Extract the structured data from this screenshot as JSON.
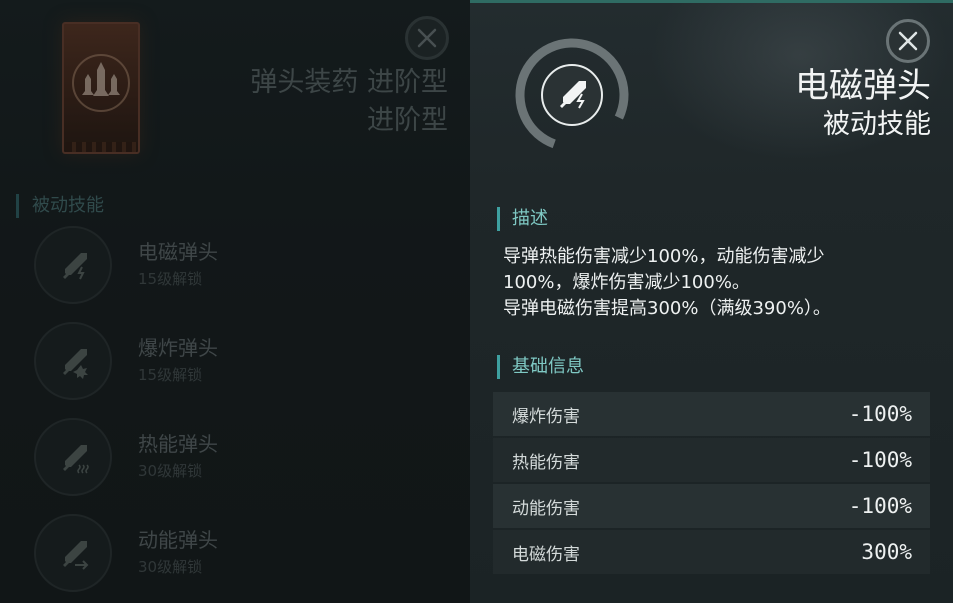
{
  "left_panel": {
    "title": "弹头装药 进阶型",
    "subtitle": "进阶型",
    "section_label": "被动技能",
    "skills": [
      {
        "name": "电磁弹头",
        "unlock": "15级解锁",
        "icon": "missile-electric-icon"
      },
      {
        "name": "爆炸弹头",
        "unlock": "15级解锁",
        "icon": "missile-explosive-icon"
      },
      {
        "name": "热能弹头",
        "unlock": "30级解锁",
        "icon": "missile-thermal-icon"
      },
      {
        "name": "动能弹头",
        "unlock": "30级解锁",
        "icon": "missile-kinetic-icon"
      }
    ]
  },
  "detail": {
    "skill_name": "电磁弹头",
    "skill_type": "被动技能",
    "description_label": "描述",
    "description_lines": [
      "导弹热能伤害减少100%，动能伤害减少",
      "100%，爆炸伤害减少100%。",
      "导弹电磁伤害提高300%（满级390%）。"
    ],
    "basic_info_label": "基础信息",
    "stats": [
      {
        "label": "爆炸伤害",
        "value": "-100%"
      },
      {
        "label": "热能伤害",
        "value": "-100%"
      },
      {
        "label": "动能伤害",
        "value": "-100%"
      },
      {
        "label": "电磁伤害",
        "value": "300%"
      }
    ]
  },
  "colors": {
    "accent": "#3ea0a0",
    "section_text": "#7fc9c4",
    "panel_bg": "#1f2729"
  }
}
